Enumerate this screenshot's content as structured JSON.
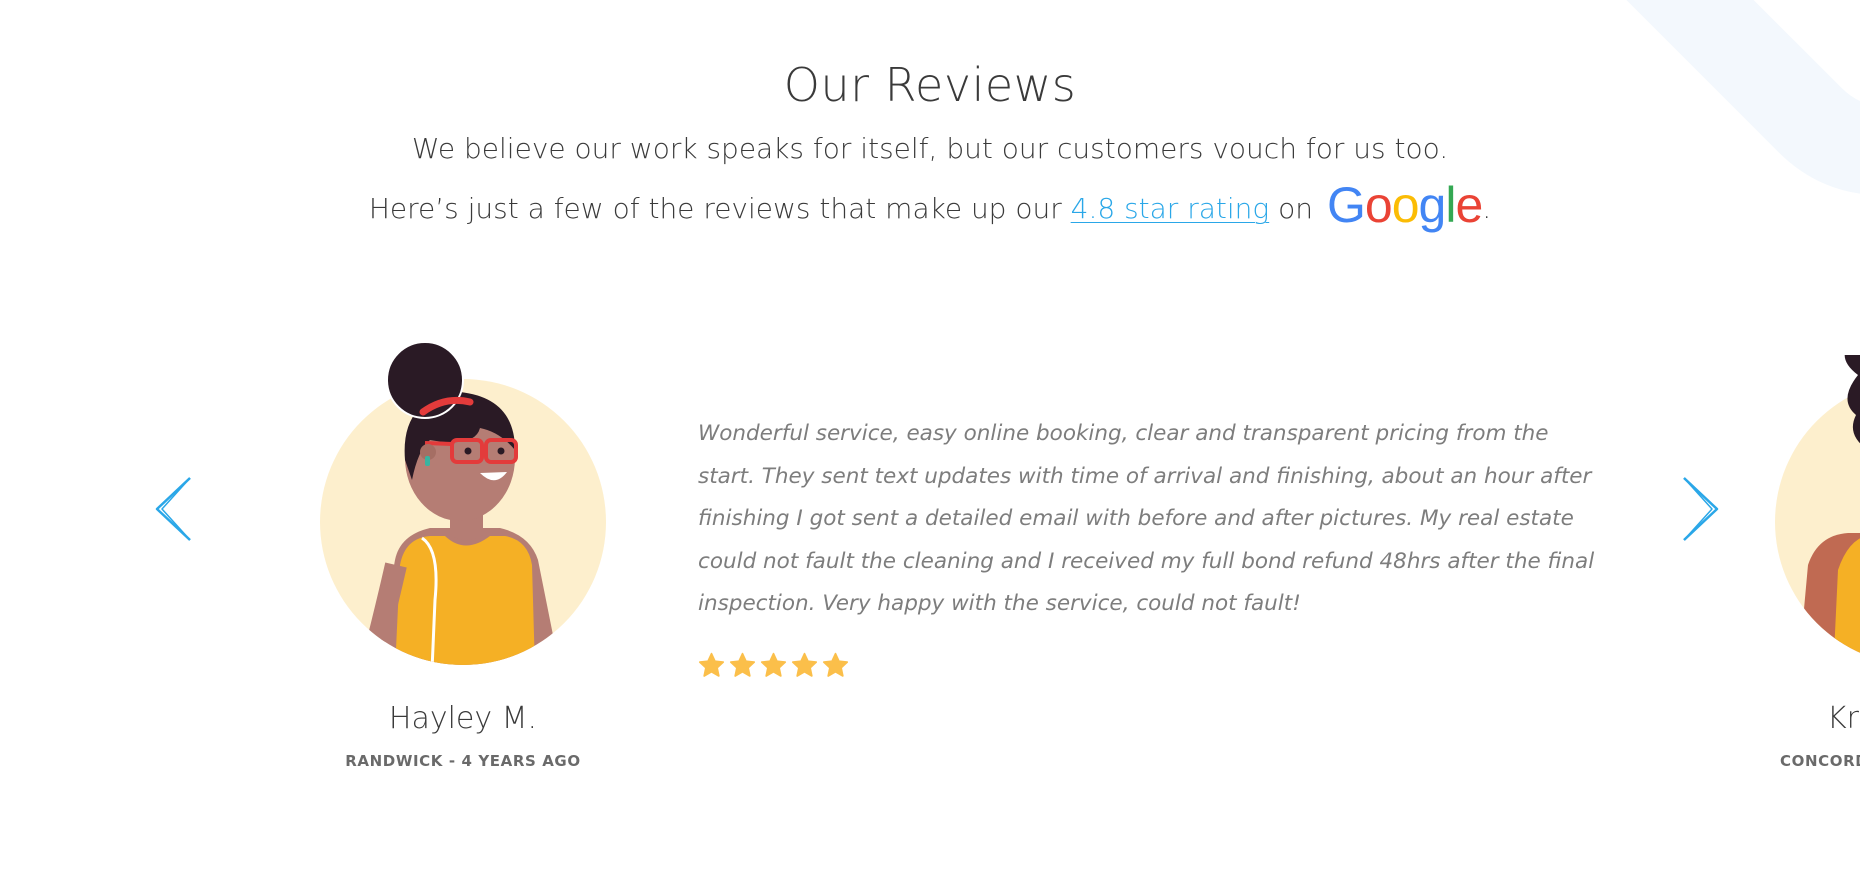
{
  "header": {
    "title": "Our Reviews",
    "line1": "We believe our work speaks for itself, but our customers vouch for us too.",
    "line2_prefix": "Here’s just a few of the reviews that make up our ",
    "rating_link": "4.8 star rating",
    "line2_mid": " on",
    "line2_suffix": ".",
    "google_logo": "Google"
  },
  "carousel": {
    "prev_icon": "chevron-left-icon",
    "next_icon": "chevron-right-icon",
    "arrow_color": "#2aa7e8",
    "current": {
      "name": "Hayley M.",
      "meta": "RANDWICK - 4 YEARS AGO",
      "review": "Wonderful service, easy online booking, clear and transparent pricing from the start. They sent text updates with time of arrival and finishing, about an hour after finishing I got sent a detailed email with before and after pictures. My real estate could not fault the cleaning and I received my full bond refund 48hrs after the final inspection. Very happy with the service, could not fault!",
      "rating": 5,
      "star_color": "#fbbf4a"
    },
    "next_peek": {
      "name": "Kri",
      "meta": "CONCORD"
    }
  },
  "colors": {
    "accent": "#2aa7e8",
    "avatar_bg": "#fdefcd",
    "shirt": "#f5b025"
  }
}
